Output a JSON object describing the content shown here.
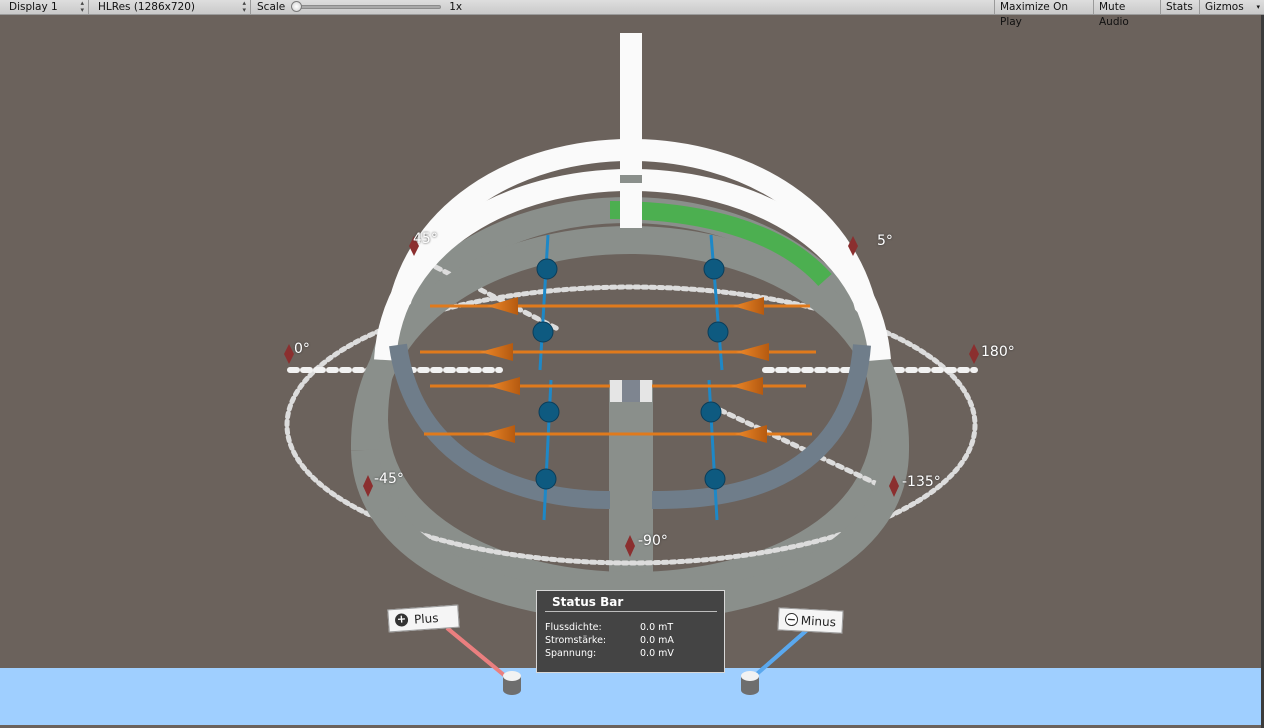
{
  "toolbar": {
    "display": "Display 1",
    "resolution": "HLRes (1286x720)",
    "scale_label": "Scale",
    "scale_value": "1x",
    "scale_level": 0.0,
    "maximize": "Maximize On Play",
    "mute": "Mute Audio",
    "stats": "Stats",
    "gizmos": "Gizmos"
  },
  "angles": {
    "a45": "45°",
    "a135": "5°",
    "a0": "0°",
    "a180": "180°",
    "am45": "-45°",
    "am135": "-135°",
    "am90": "-90°"
  },
  "status_bar": {
    "title": "Status Bar",
    "rows": [
      {
        "label": "Flussdichte:",
        "value": "0.0 mT"
      },
      {
        "label": "Stromstärke:",
        "value": "0.0 mA"
      },
      {
        "label": "Spannung:",
        "value": "0.0 mV"
      }
    ]
  },
  "terminals": {
    "plus": "Plus",
    "minus": "Minus"
  },
  "colors": {
    "background": "#6b625c",
    "floor": "#9fcfff",
    "coil": "#8a8f8b",
    "coil_highlight": "#ffffff",
    "progress_green": "#4caf50",
    "conductor": "#e07a1c",
    "field_line": "#1e88c7",
    "marker": "#8b2f2f"
  }
}
